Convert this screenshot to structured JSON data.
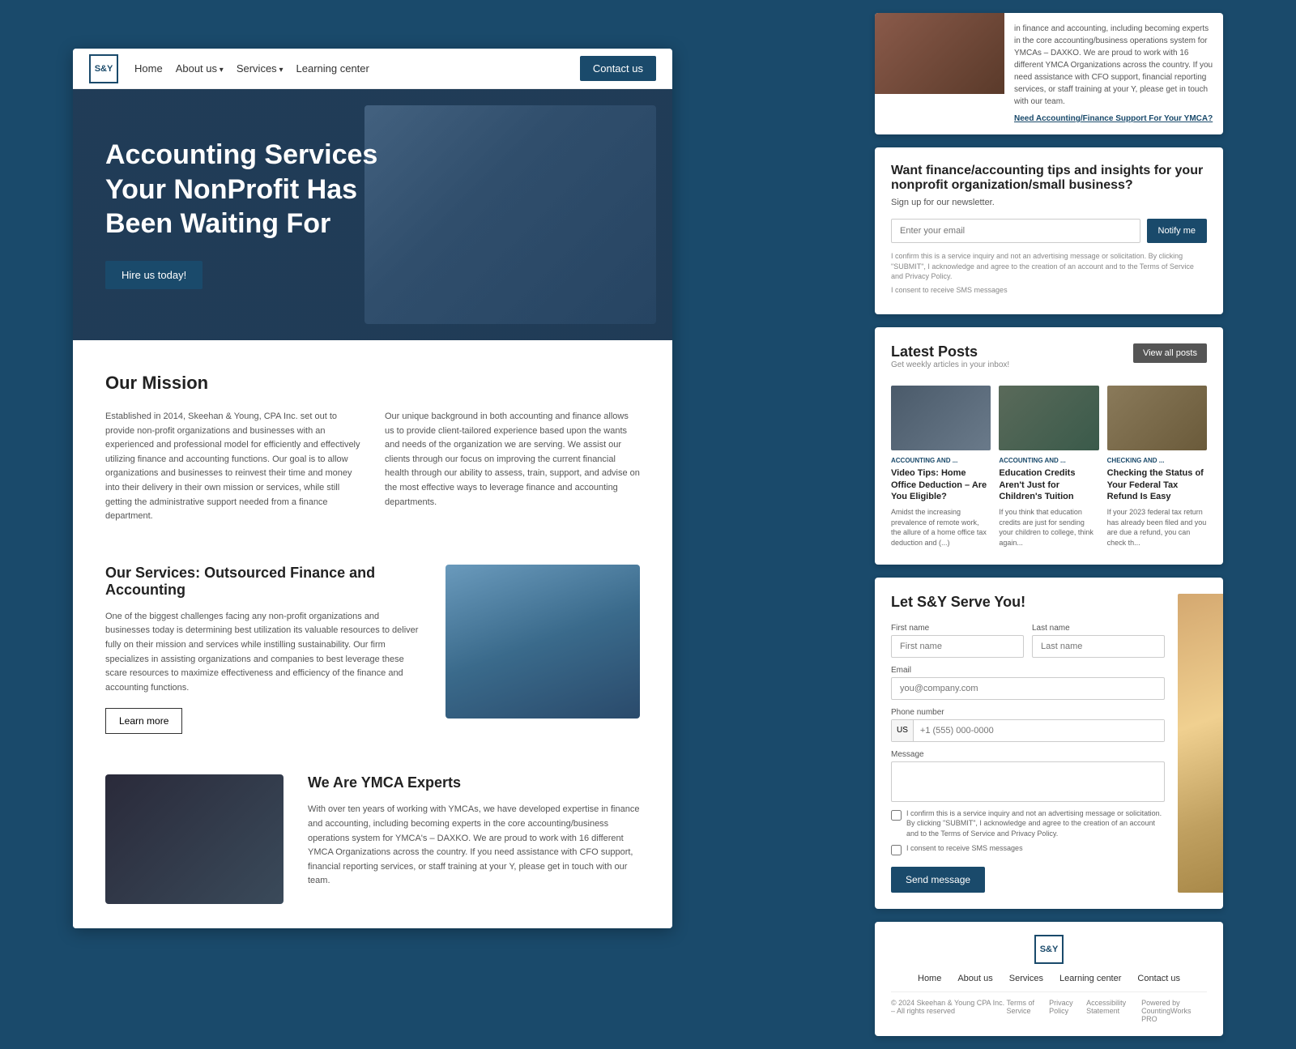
{
  "site": {
    "logo": "S&Y",
    "name": "Skeehan & Young CPA"
  },
  "navbar": {
    "home_label": "Home",
    "about_label": "About us",
    "services_label": "Services",
    "learning_label": "Learning center",
    "contact_label": "Contact us"
  },
  "hero": {
    "title": "Accounting Services Your NonProfit Has Been Waiting For",
    "cta_button": "Hire us today!"
  },
  "mission": {
    "title": "Our Mission",
    "col1": "Established in 2014, Skeehan & Young, CPA Inc. set out to provide non-profit organizations and businesses with an experienced and professional model for efficiently and effectively utilizing finance and accounting functions. Our goal is to allow organizations and businesses to reinvest their time and money into their delivery in their own mission or services, while still getting the administrative support needed from a finance department.",
    "col2": "Our unique background in both accounting and finance allows us to provide client-tailored experience based upon the wants and needs of the organization we are serving. We assist our clients through our focus on improving the current financial health through our ability to assess, train, support, and advise on the most effective ways to leverage finance and accounting departments."
  },
  "services": {
    "title": "Our Services: Outsourced Finance and Accounting",
    "description": "One of the biggest challenges facing any non-profit organizations and businesses today is determining best utilization its valuable resources to deliver fully on their mission and services while instilling sustainability. Our firm specializes in assisting organizations and companies to best leverage these scare resources to maximize effectiveness and efficiency of the finance and accounting functions.",
    "button": "Learn more"
  },
  "ymca": {
    "title": "We Are YMCA Experts",
    "description": "With over ten years of working with YMCAs, we have developed expertise in finance and accounting, including becoming experts in the core accounting/business operations system for YMCA's – DAXKO. We are proud to work with 16 different YMCA Organizations across the country. If you need assistance with CFO support, financial reporting services, or staff training at your Y, please get in touch with our team."
  },
  "right_panel": {
    "top_card": {
      "text": "in finance and accounting, including becoming experts in the core accounting/business operations system for YMCAs – DAXKO. We are proud to work with 16 different YMCA Organizations across the country. If you need assistance with CFO support, financial reporting services, or staff training at your Y, please get in touch with our team.",
      "link": "Need Accounting/Finance Support For Your YMCA?"
    },
    "newsletter": {
      "title": "Want finance/accounting tips and insights for your nonprofit organization/small business?",
      "subtitle": "Sign up for our newsletter.",
      "input_placeholder": "Enter your email",
      "button": "Notify me",
      "fine1": "I confirm this is a service inquiry and not an advertising message or solicitation. By clicking \"SUBMIT\", I acknowledge and agree to the creation of an account and to the Terms of Service and Privacy Policy.",
      "fine2": "I consent to receive SMS messages"
    },
    "latest_posts": {
      "title": "Latest Posts",
      "subtitle": "Get weekly articles in your inbox!",
      "view_all": "View all posts",
      "posts": [
        {
          "category": "ACCOUNTING AND ...",
          "title": "Video Tips: Home Office Deduction – Are You Eligible?",
          "excerpt": "Amidst the increasing prevalence of remote work, the allure of a home office tax deduction and (...)"
        },
        {
          "category": "ACCOUNTING AND ...",
          "title": "Education Credits Aren't Just for Children's Tuition",
          "excerpt": "If you think that education credits are just for sending your children to college, think again..."
        },
        {
          "category": "CHECKING AND ...",
          "title": "Checking the Status of Your Federal Tax Refund Is Easy",
          "excerpt": "If your 2023 federal tax return has already been filed and you are due a refund, you can check th..."
        }
      ]
    },
    "contact_form": {
      "title": "Let S&Y Serve You!",
      "first_name_label": "First name",
      "first_name_placeholder": "First name",
      "last_name_label": "Last name",
      "last_name_placeholder": "Last name",
      "email_label": "Email",
      "email_placeholder": "you@company.com",
      "phone_label": "Phone number",
      "phone_country": "US",
      "phone_placeholder": "+1 (555) 000-0000",
      "message_label": "Message",
      "checkbox1": "I confirm this is a service inquiry and not an advertising message or solicitation. By clicking \"SUBMIT\", I acknowledge and agree to the creation of an account and to the Terms of Service and Privacy Policy.",
      "checkbox2": "I consent to receive SMS messages",
      "send_button": "Send message"
    },
    "footer": {
      "logo": "S&Y",
      "nav": [
        "Home",
        "About us",
        "Services",
        "Learning center",
        "Contact us"
      ],
      "copyright": "© 2024 Skeehan & Young CPA Inc. – All rights reserved",
      "terms": "Terms of Service",
      "privacy": "Privacy Policy",
      "accessibility": "Accessibility Statement",
      "powered": "Powered by CountingWorks PRO"
    }
  }
}
